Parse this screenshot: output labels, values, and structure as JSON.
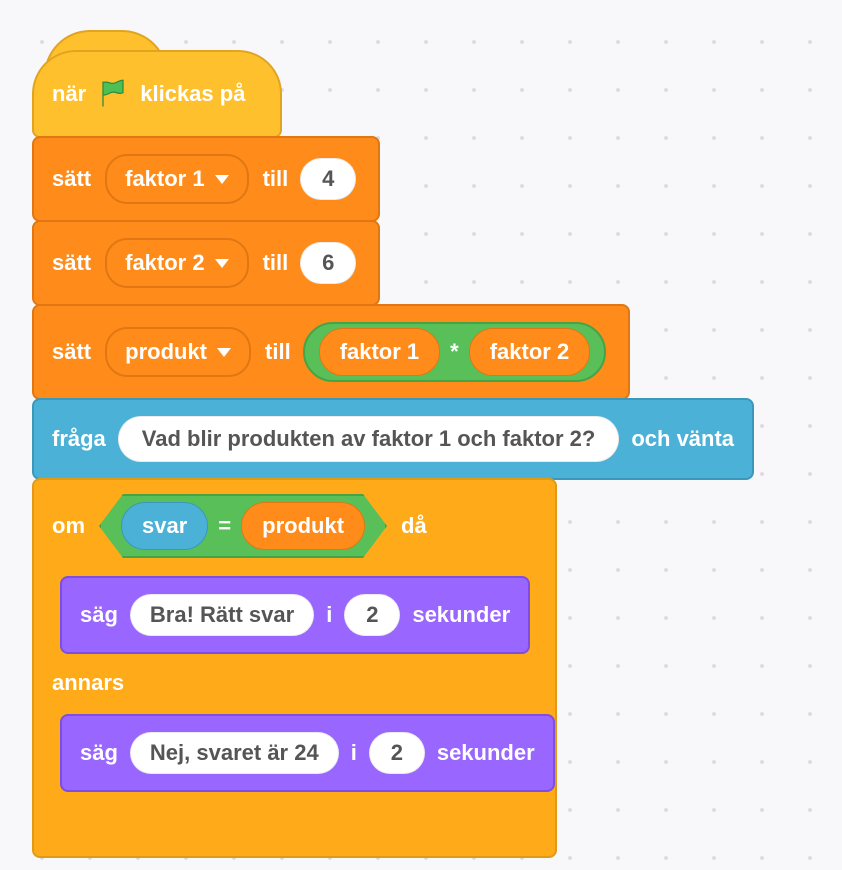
{
  "hat": {
    "prefix": "när",
    "suffix": "klickas på"
  },
  "set1": {
    "set": "sätt",
    "var": "faktor 1",
    "to": "till",
    "val": "4"
  },
  "set2": {
    "set": "sätt",
    "var": "faktor 2",
    "to": "till",
    "val": "6"
  },
  "set3": {
    "set": "sätt",
    "var": "produkt",
    "to": "till",
    "a": "faktor 1",
    "op": "*",
    "b": "faktor 2"
  },
  "ask": {
    "pre": "fråga",
    "q": "Vad blir produkten av faktor 1 och faktor 2?",
    "post": "och vänta"
  },
  "if": {
    "if": "om",
    "then": "då",
    "else": "annars",
    "left": "svar",
    "cmp": "=",
    "right": "produkt"
  },
  "say1": {
    "say": "säg",
    "msg": "Bra! Rätt svar",
    "for": "i",
    "sec": "2",
    "unit": "sekunder"
  },
  "say2": {
    "say": "säg",
    "msg": "Nej, svaret är 24",
    "for": "i",
    "sec": "2",
    "unit": "sekunder"
  }
}
